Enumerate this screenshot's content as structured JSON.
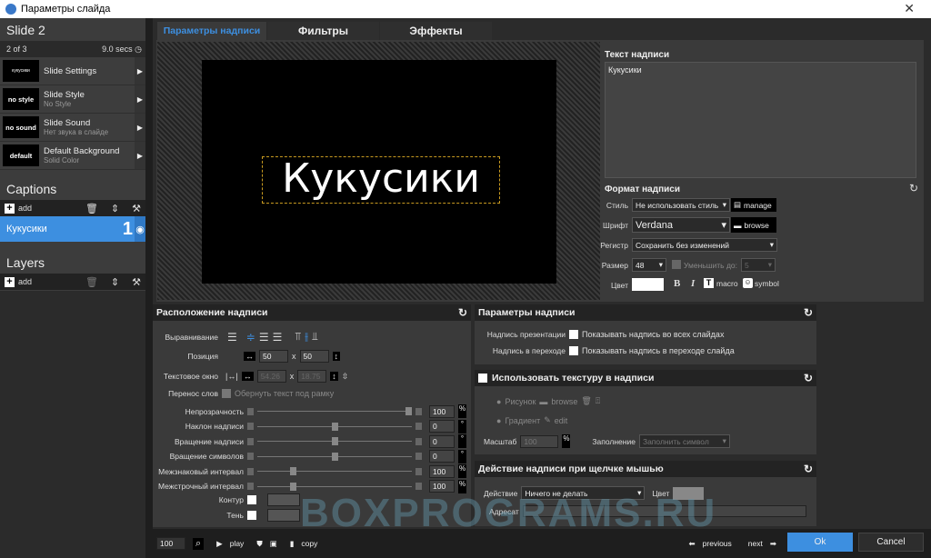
{
  "window": {
    "title": "Параметры слайда",
    "close": "✕"
  },
  "sidebar": {
    "slide_title": "Slide 2",
    "position": "2 of 3",
    "duration": "9.0 secs",
    "items": [
      {
        "thumb": "кукусики",
        "title": "Slide Settings",
        "sub": ""
      },
      {
        "thumb": "no style",
        "title": "Slide Style",
        "sub": "No Style"
      },
      {
        "thumb": "no sound",
        "title": "Slide Sound",
        "sub": "Нет звука в слайде"
      },
      {
        "thumb": "default",
        "title": "Default Background",
        "sub": "Solid Color"
      }
    ],
    "captions_title": "Captions",
    "add": "add",
    "caption_item": {
      "label": "Кукусики",
      "number": "1"
    },
    "layers_title": "Layers"
  },
  "tabs": [
    "Параметры надписи",
    "Фильтры",
    "Эффекты"
  ],
  "preview": {
    "caption": "Кукусики"
  },
  "text_panel": {
    "title": "Текст надписи",
    "value": "Кукусики"
  },
  "format": {
    "title": "Формат надписи",
    "style_label": "Стиль",
    "style_value": "Не использовать стиль",
    "manage": "manage",
    "font_label": "Шрифт",
    "font_value": "Verdana",
    "browse": "browse",
    "case_label": "Регистр",
    "case_value": "Сохранить без изменений",
    "size_label": "Размер",
    "size_value": "48",
    "shrink_label": "Уменьшить до:",
    "shrink_value": "5",
    "color_label": "Цвет",
    "color_value": "#ffffff",
    "bold": "B",
    "italic": "I",
    "macro": "macro",
    "symbol": "symbol"
  },
  "layout": {
    "title": "Расположение надписи",
    "align_label": "Выравнивание",
    "pos_label": "Позиция",
    "pos_x": "50",
    "pos_y": "50",
    "x": "x",
    "box_label": "Текстовое окно",
    "box_w": "54.26",
    "box_h": "18.75",
    "wrap_label": "Перенос слов",
    "wrap_text": "Обернуть текст под рамку",
    "sliders": [
      {
        "label": "Непрозрачность",
        "value": "100",
        "unit": "%",
        "level": 1.0
      },
      {
        "label": "Наклон надписи",
        "value": "0",
        "unit": "°",
        "level": 0.5
      },
      {
        "label": "Вращение надписи",
        "value": "0",
        "unit": "°",
        "level": 0.5
      },
      {
        "label": "Вращение символов",
        "value": "0",
        "unit": "°",
        "level": 0.5
      },
      {
        "label": "Межзнаковый интервал",
        "value": "100",
        "unit": "%",
        "level": 0.22
      },
      {
        "label": "Межстрочный интервал",
        "value": "100",
        "unit": "%",
        "level": 0.22
      }
    ],
    "outline_label": "Контур",
    "shadow_label": "Тень"
  },
  "params": {
    "title": "Параметры надписи",
    "pres_label": "Надпись презентации",
    "pres_text": "Показывать надпись во всех слайдах",
    "trans_label": "Надпись в переходе",
    "trans_text": "Показывать надпись в переходе слайда"
  },
  "texture": {
    "title": "Использовать текстуру в надписи",
    "image": "Рисунок",
    "browse": "browse",
    "gradient": "Градиент",
    "edit": "edit",
    "scale_label": "Масштаб",
    "scale_value": "100",
    "fill_label": "Заполнение",
    "fill_value": "Заполнить символ"
  },
  "action": {
    "title": "Действие надписи при щелчке мышью",
    "action_label": "Действие",
    "action_value": "Ничего не делать",
    "color_label": "Цвет",
    "target_label": "Адресат"
  },
  "footer": {
    "zoom": "100",
    "play": "play",
    "copy": "copy",
    "previous": "previous",
    "next": "next",
    "ok": "Ok",
    "cancel": "Cancel"
  },
  "watermark": "BOXPROGRAMS.RU",
  "colors": {
    "accent": "#3d8fe0",
    "bg": "#2b2b2b",
    "panel": "#3a3a3a"
  }
}
